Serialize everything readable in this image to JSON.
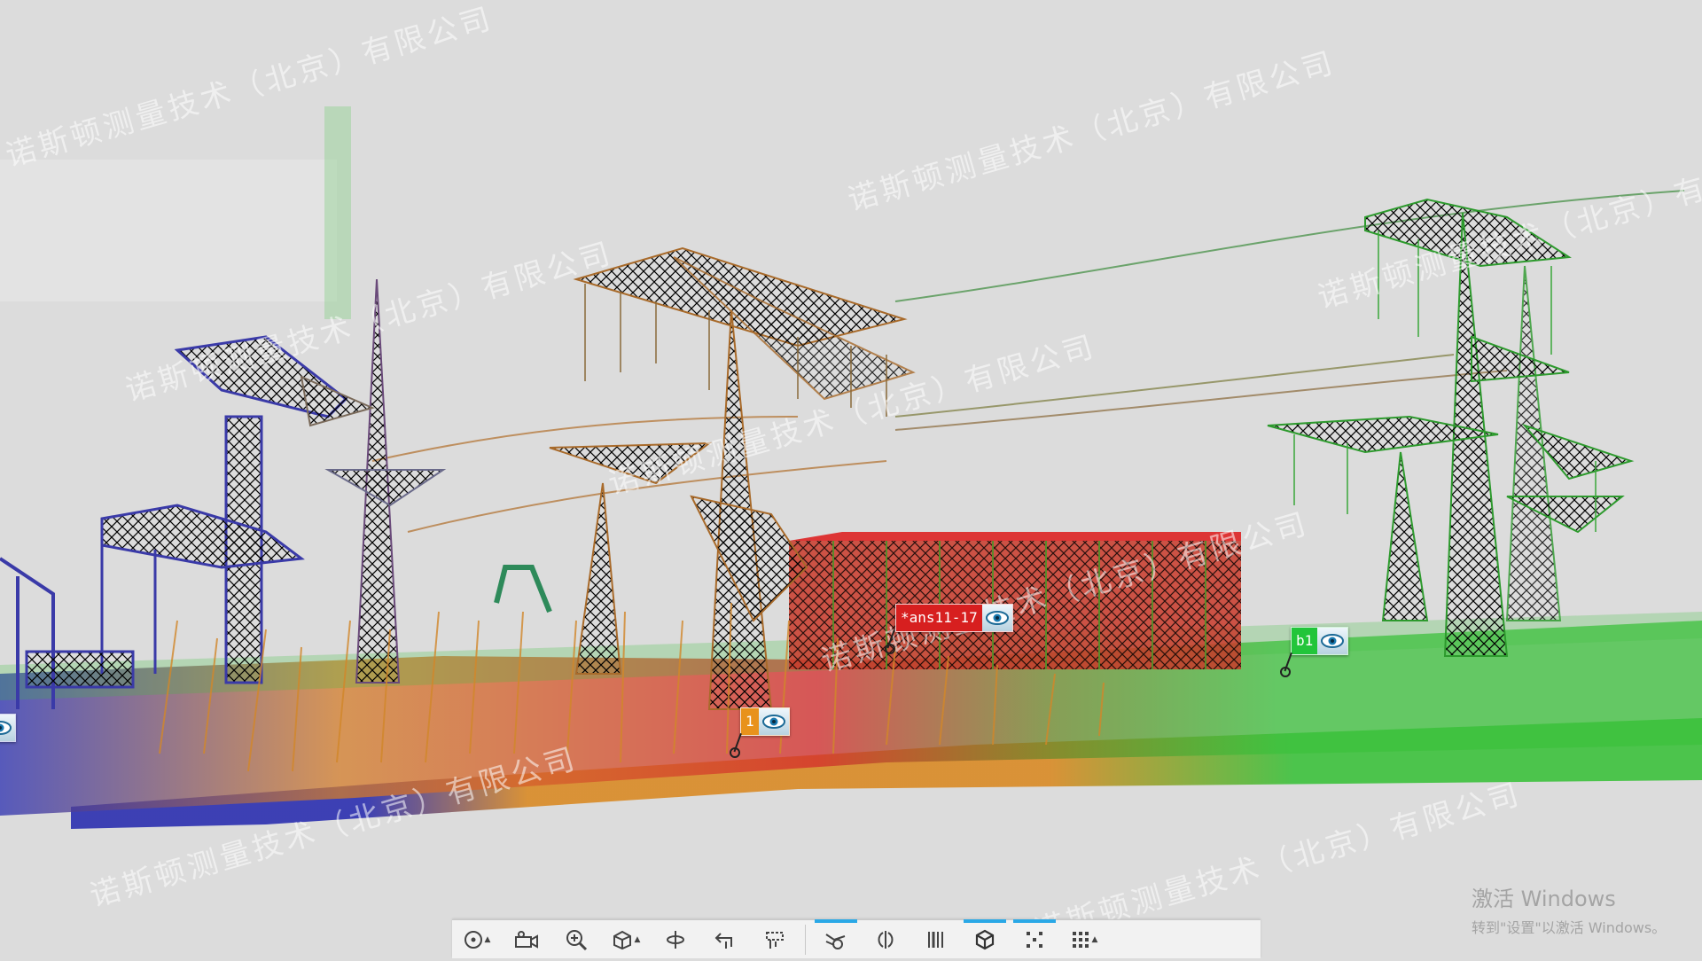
{
  "watermark_text": "诺斯顿测量技术（北京）有限公司",
  "tags": [
    {
      "id": "tag-ans11-17",
      "label": "*ans11-17",
      "color": "#d71f1f"
    },
    {
      "id": "tag-b1",
      "label": "b1",
      "color": "#22c53a"
    },
    {
      "id": "tag-1",
      "label": "1",
      "color": "#e8921c"
    }
  ],
  "activation": {
    "line1": "激活 Windows",
    "line2": "转到\"设置\"以激活 Windows。"
  },
  "toolbar": {
    "buttons": [
      {
        "name": "orbit-center",
        "icon": "target-icon",
        "has_menu": true,
        "active": false
      },
      {
        "name": "camera",
        "icon": "camera-icon",
        "has_menu": false,
        "active": false
      },
      {
        "name": "zoom",
        "icon": "zoom-icon",
        "has_menu": false,
        "active": false
      },
      {
        "name": "view-cube",
        "icon": "cube-icon",
        "has_menu": true,
        "active": false
      },
      {
        "name": "rotate",
        "icon": "rotate-icon",
        "has_menu": false,
        "active": false
      },
      {
        "name": "undo-view",
        "icon": "undo-view-icon",
        "has_menu": false,
        "active": false
      },
      {
        "name": "pick",
        "icon": "pick-icon",
        "has_menu": false,
        "active": false
      },
      {
        "name": "clip-tool",
        "icon": "clip-icon",
        "has_menu": false,
        "active": true
      },
      {
        "name": "section",
        "icon": "section-icon",
        "has_menu": false,
        "active": false
      },
      {
        "name": "slice",
        "icon": "slice-icon",
        "has_menu": false,
        "active": false
      },
      {
        "name": "box",
        "icon": "box-icon",
        "has_menu": false,
        "active": true
      },
      {
        "name": "points",
        "icon": "points-icon",
        "has_menu": false,
        "active": true
      },
      {
        "name": "grid-menu",
        "icon": "grid-icon",
        "has_menu": true,
        "active": false
      }
    ]
  }
}
